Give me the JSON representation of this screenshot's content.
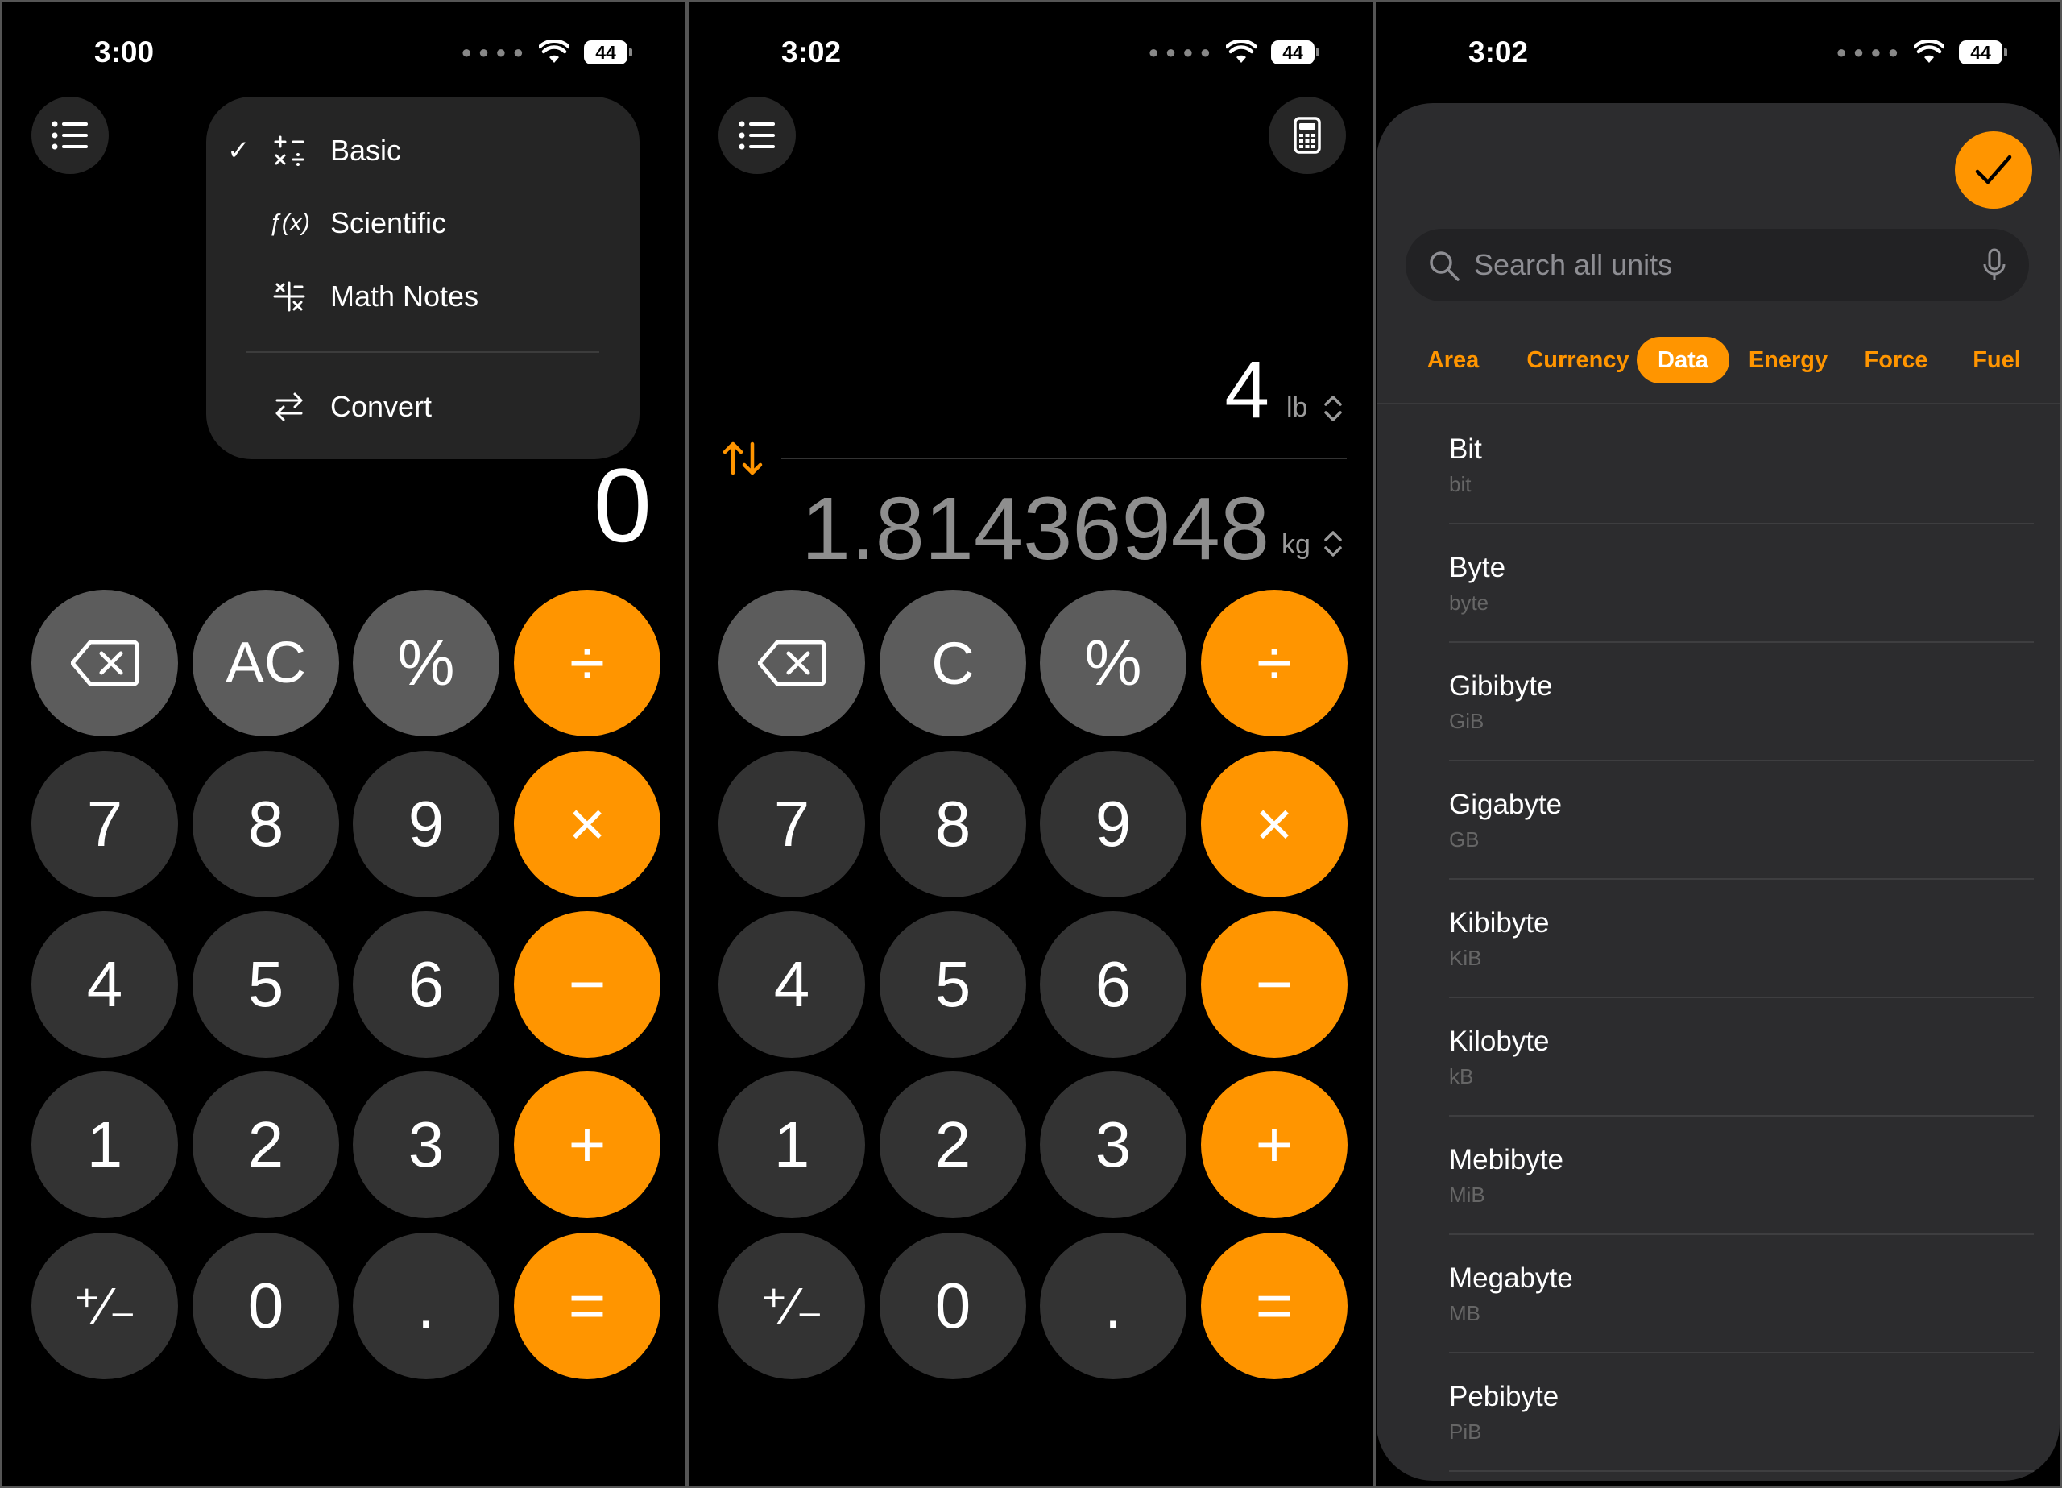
{
  "phone1": {
    "status": {
      "time": "3:00",
      "battery": "44"
    },
    "menu": {
      "items": [
        {
          "label": "Basic",
          "icon": "basic-ops-icon",
          "checked": true
        },
        {
          "label": "Scientific",
          "icon": "function-icon",
          "checked": false
        },
        {
          "label": "Math Notes",
          "icon": "math-notes-icon",
          "checked": false
        },
        {
          "label": "Convert",
          "icon": "convert-arrows-icon",
          "checked": false
        }
      ]
    },
    "display": "0",
    "keys": {
      "clear": "AC",
      "percent": "%",
      "divide": "÷",
      "multiply": "×",
      "minus": "−",
      "plus": "+",
      "equals": "=",
      "plusminus": "⁺∕₋",
      "decimal": ".",
      "d7": "7",
      "d8": "8",
      "d9": "9",
      "d4": "4",
      "d5": "5",
      "d6": "6",
      "d1": "1",
      "d2": "2",
      "d3": "3",
      "d0": "0"
    }
  },
  "phone2": {
    "status": {
      "time": "3:02",
      "battery": "44"
    },
    "converter": {
      "input_value": "4",
      "input_unit": "lb",
      "output_value": "1.81436948",
      "output_unit": "kg"
    },
    "keys": {
      "clear": "C",
      "percent": "%",
      "divide": "÷",
      "multiply": "×",
      "minus": "−",
      "plus": "+",
      "equals": "=",
      "plusminus": "⁺∕₋",
      "decimal": ".",
      "d7": "7",
      "d8": "8",
      "d9": "9",
      "d4": "4",
      "d5": "5",
      "d6": "6",
      "d1": "1",
      "d2": "2",
      "d3": "3",
      "d0": "0"
    }
  },
  "phone3": {
    "status": {
      "time": "3:02",
      "battery": "44"
    },
    "search": {
      "placeholder": "Search all units"
    },
    "tabs": [
      {
        "label": "Area",
        "active": false
      },
      {
        "label": "Currency",
        "active": false
      },
      {
        "label": "Data",
        "active": true
      },
      {
        "label": "Energy",
        "active": false
      },
      {
        "label": "Force",
        "active": false
      },
      {
        "label": "Fuel",
        "active": false
      }
    ],
    "units": [
      {
        "name": "Bit",
        "abbr": "bit"
      },
      {
        "name": "Byte",
        "abbr": "byte"
      },
      {
        "name": "Gibibyte",
        "abbr": "GiB"
      },
      {
        "name": "Gigabyte",
        "abbr": "GB"
      },
      {
        "name": "Kibibyte",
        "abbr": "KiB"
      },
      {
        "name": "Kilobyte",
        "abbr": "kB"
      },
      {
        "name": "Mebibyte",
        "abbr": "MiB"
      },
      {
        "name": "Megabyte",
        "abbr": "MB"
      },
      {
        "name": "Pebibyte",
        "abbr": "PiB"
      }
    ]
  },
  "colors": {
    "accent": "#ff9500",
    "key_num": "#333333",
    "key_fn": "#5c5c5c",
    "background": "#000000"
  }
}
